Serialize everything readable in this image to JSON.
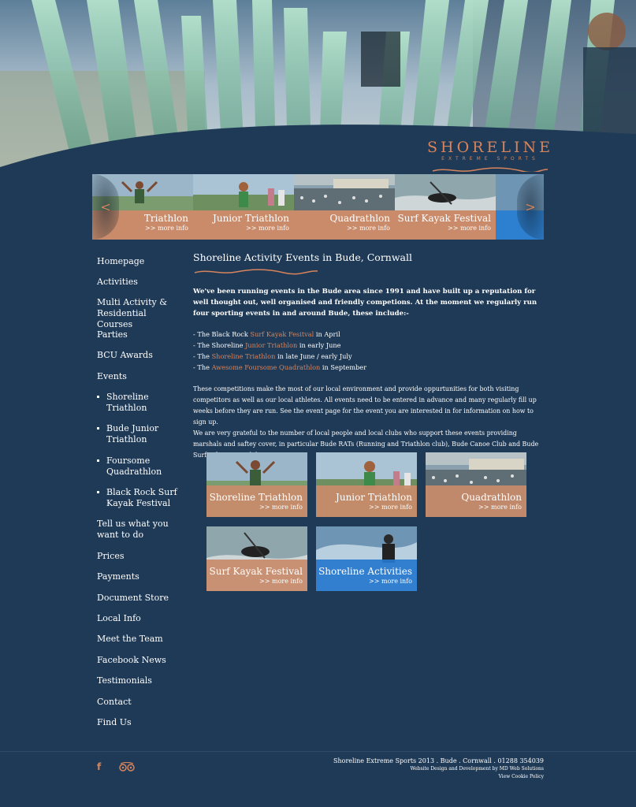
{
  "header": {
    "logo_name": "SHORELINE",
    "logo_tagline": "EXTREME SPORTS",
    "hero_icon": "trophy-hero-image"
  },
  "slider": {
    "prev_arrow": "<",
    "next_arrow": ">",
    "slides": [
      {
        "title": "Triathlon",
        "more": ">> more info"
      },
      {
        "title": "Junior Triathlon",
        "more": ">> more info"
      },
      {
        "title": "Quadrathlon",
        "more": ">> more info"
      },
      {
        "title": "Surf Kayak Festival",
        "more": ">> more info"
      }
    ]
  },
  "sidebar": {
    "items": [
      {
        "label": "Homepage"
      },
      {
        "label": "Activities"
      },
      {
        "label": "Multi Activity & Residential Courses"
      },
      {
        "label": "Parties"
      },
      {
        "label": "BCU Awards"
      },
      {
        "label": "Events"
      },
      {
        "label": "Shoreline Triathlon"
      },
      {
        "label": "Bude Junior Triathlon"
      },
      {
        "label": "Foursome Quadrathlon"
      },
      {
        "label": "Black Rock Surf Kayak Festival"
      },
      {
        "label": "Tell us what you want to do"
      },
      {
        "label": "Prices"
      },
      {
        "label": "Payments"
      },
      {
        "label": "Document Store"
      },
      {
        "label": "Local Info"
      },
      {
        "label": "Meet the Team"
      },
      {
        "label": "Facebook News"
      },
      {
        "label": "Testimonials"
      },
      {
        "label": "Contact"
      },
      {
        "label": "Find Us"
      }
    ]
  },
  "main": {
    "title": "Shoreline Activity Events in Bude, Cornwall",
    "intro": "We've been running events in the Bude area since 1991 and have built up a reputation for well thought out, well organised and friendly competions. At the moment we regularly run four sporting events in and around Bude, these include:-",
    "events": [
      {
        "pre": "- The Black Rock ",
        "link": "Surf Kayak Fesitval",
        "post": " in April"
      },
      {
        "pre": "- The Shoreline ",
        "link": "Junior Triathlon",
        "post": " in early June"
      },
      {
        "pre": "- The ",
        "link": "Shoreline Triathlon",
        "post": " in late June / early July"
      },
      {
        "pre": "- The ",
        "link": "Awesome Foursome Quadrathlon",
        "post": " in September"
      }
    ],
    "para1": "These competitions make the most of our local environment and provide oppurtunities for both visiting competitors as well as our local athletes. All events need to be entered in advance and many regularly fill up weeks before they are run. See the event page for the event you are interested in for information on how to sign up.",
    "para2": "We are very grateful to the number of local people and local clubs who support these events providing marshals and saftey cover, in particular Bude RATs (Running and Triathlon club), Bude Canoe Club and Bude Surf Life Saving club."
  },
  "tiles": [
    {
      "title": "Shoreline Triathlon",
      "more": ">> more info"
    },
    {
      "title": "Junior Triathlon",
      "more": ">> more info"
    },
    {
      "title": "Quadrathlon",
      "more": ">> more info"
    },
    {
      "title": "Surf Kayak Festival",
      "more": ">> more info"
    },
    {
      "title": "Shoreline Activities",
      "more": ">> more info"
    }
  ],
  "footer": {
    "facebook_icon": "f",
    "copyright": "Shoreline Extreme Sports 2013 . Bude . Cornwall . 01288 354039",
    "credit": "Website Design and Development by MD Web Solutions",
    "cookie": "View Cookie Policy"
  },
  "colors": {
    "background": "#1f3a56",
    "accent": "#d7845d",
    "caption": "#c98b6a",
    "tile_blue": "#2678cd"
  }
}
